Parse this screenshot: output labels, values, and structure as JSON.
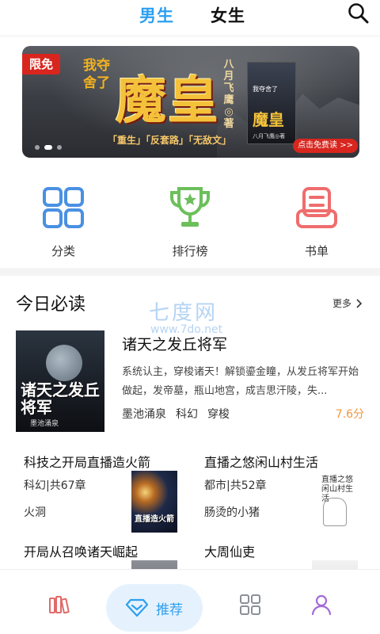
{
  "header": {
    "tabs": [
      {
        "label": "男生",
        "active": true
      },
      {
        "label": "女生",
        "active": false
      }
    ],
    "search_icon": "search-icon"
  },
  "banner": {
    "badge": "限免",
    "circle_text": "我夺舍了",
    "title": "魔皇",
    "author": "八月飞鹰◎著",
    "tags": "「重生」「反套路」「无敌文」",
    "mini_cover_series": "我夺舍了",
    "mini_cover_title": "魔皇",
    "mini_cover_author": "八月飞鹰◎著",
    "cta": "点击免费读 >>",
    "page_count": 3,
    "active_page": 1
  },
  "quick_entries": [
    {
      "label": "分类",
      "icon": "category-grid-icon",
      "color": "#4a90e2"
    },
    {
      "label": "排行榜",
      "icon": "trophy-icon",
      "color": "#6cbf5c"
    },
    {
      "label": "书单",
      "icon": "booklist-icon",
      "color": "#ef6d6d"
    }
  ],
  "today": {
    "title": "今日必读",
    "more": "更多",
    "watermark": "七度网",
    "watermark_url": "www.7do.net",
    "featured": {
      "title": "诸天之发丘将军",
      "cover_title": "诸天之发丘将军",
      "cover_author": "墨池涌泉",
      "description": "系统认主，穿梭诸天！解锁鎏金瞳，从发丘将军开始做起，发帝墓，瓶山地宫，成吉思汗陵，失...",
      "author": "墨池涌泉",
      "genre": "科幻",
      "subgenre": "穿梭",
      "score": "7.6分"
    },
    "books": [
      {
        "title": "科技之开局直播造火箭",
        "meta": "科幻|共67章",
        "author": "火洞",
        "cover_text": "直播造火箭"
      },
      {
        "title": "直播之悠闲山村生活",
        "meta": "都市|共52章",
        "author": "肠烫的小猪",
        "cover_text": "直播之悠闲山村生活"
      },
      {
        "title": "开局从召唤诸天崛起",
        "meta": "",
        "author": "",
        "cover_text": ""
      },
      {
        "title": "大周仙吏",
        "meta": "",
        "author": "",
        "cover_text": ""
      }
    ]
  },
  "bottom_nav": [
    {
      "label": "",
      "icon": "bookshelf-icon",
      "active": false,
      "color": "#e06a6a"
    },
    {
      "label": "推荐",
      "icon": "diamond-icon",
      "active": true,
      "color": "#2d9ff0"
    },
    {
      "label": "",
      "icon": "category-grid-icon",
      "active": false,
      "color": "#8a8f98"
    },
    {
      "label": "",
      "icon": "user-icon",
      "active": false,
      "color": "#a46ad8"
    }
  ]
}
